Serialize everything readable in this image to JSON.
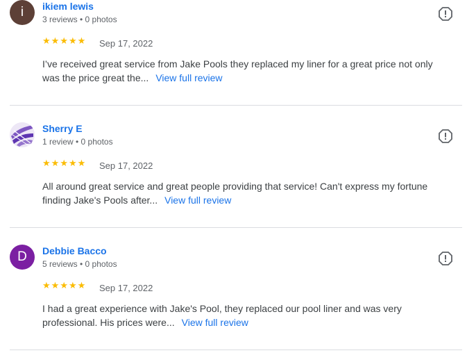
{
  "reviews": [
    {
      "avatar_letter": "i",
      "avatar_color": "#5d4037",
      "name": "ikiem lewis",
      "meta": "3 reviews • 0 photos",
      "stars": [
        "★",
        "★",
        "★",
        "★",
        "★"
      ],
      "rating": 5,
      "date": "Sep 17, 2022",
      "text": "I’ve received great service from Jake Pools they replaced my liner for a great price not only was the price great the...",
      "more_label": "View full review",
      "flag_icon": "report-icon"
    },
    {
      "avatar_letter": "",
      "avatar_color": "#7e57c2",
      "name": "Sherry E",
      "meta": "1 review • 0 photos",
      "stars": [
        "★",
        "★",
        "★",
        "★",
        "★"
      ],
      "rating": 5,
      "date": "Sep 17, 2022",
      "text": "All around great service and great people providing that service! Can't express my fortune finding Jake's Pools after...",
      "more_label": "View full review",
      "flag_icon": "report-icon"
    },
    {
      "avatar_letter": "D",
      "avatar_color": "#7b1fa2",
      "name": "Debbie Bacco",
      "meta": "5 reviews • 0 photos",
      "stars": [
        "★",
        "★",
        "★",
        "★",
        "★"
      ],
      "rating": 5,
      "date": "Sep 17, 2022",
      "text": "I had a great experience with Jake's Pool, they replaced our pool liner and was very professional. His prices were...",
      "more_label": "View full review",
      "flag_icon": "report-icon"
    }
  ],
  "colors": {
    "link": "#1a73e8",
    "star": "#fbbc04",
    "divider": "#dadce0"
  }
}
